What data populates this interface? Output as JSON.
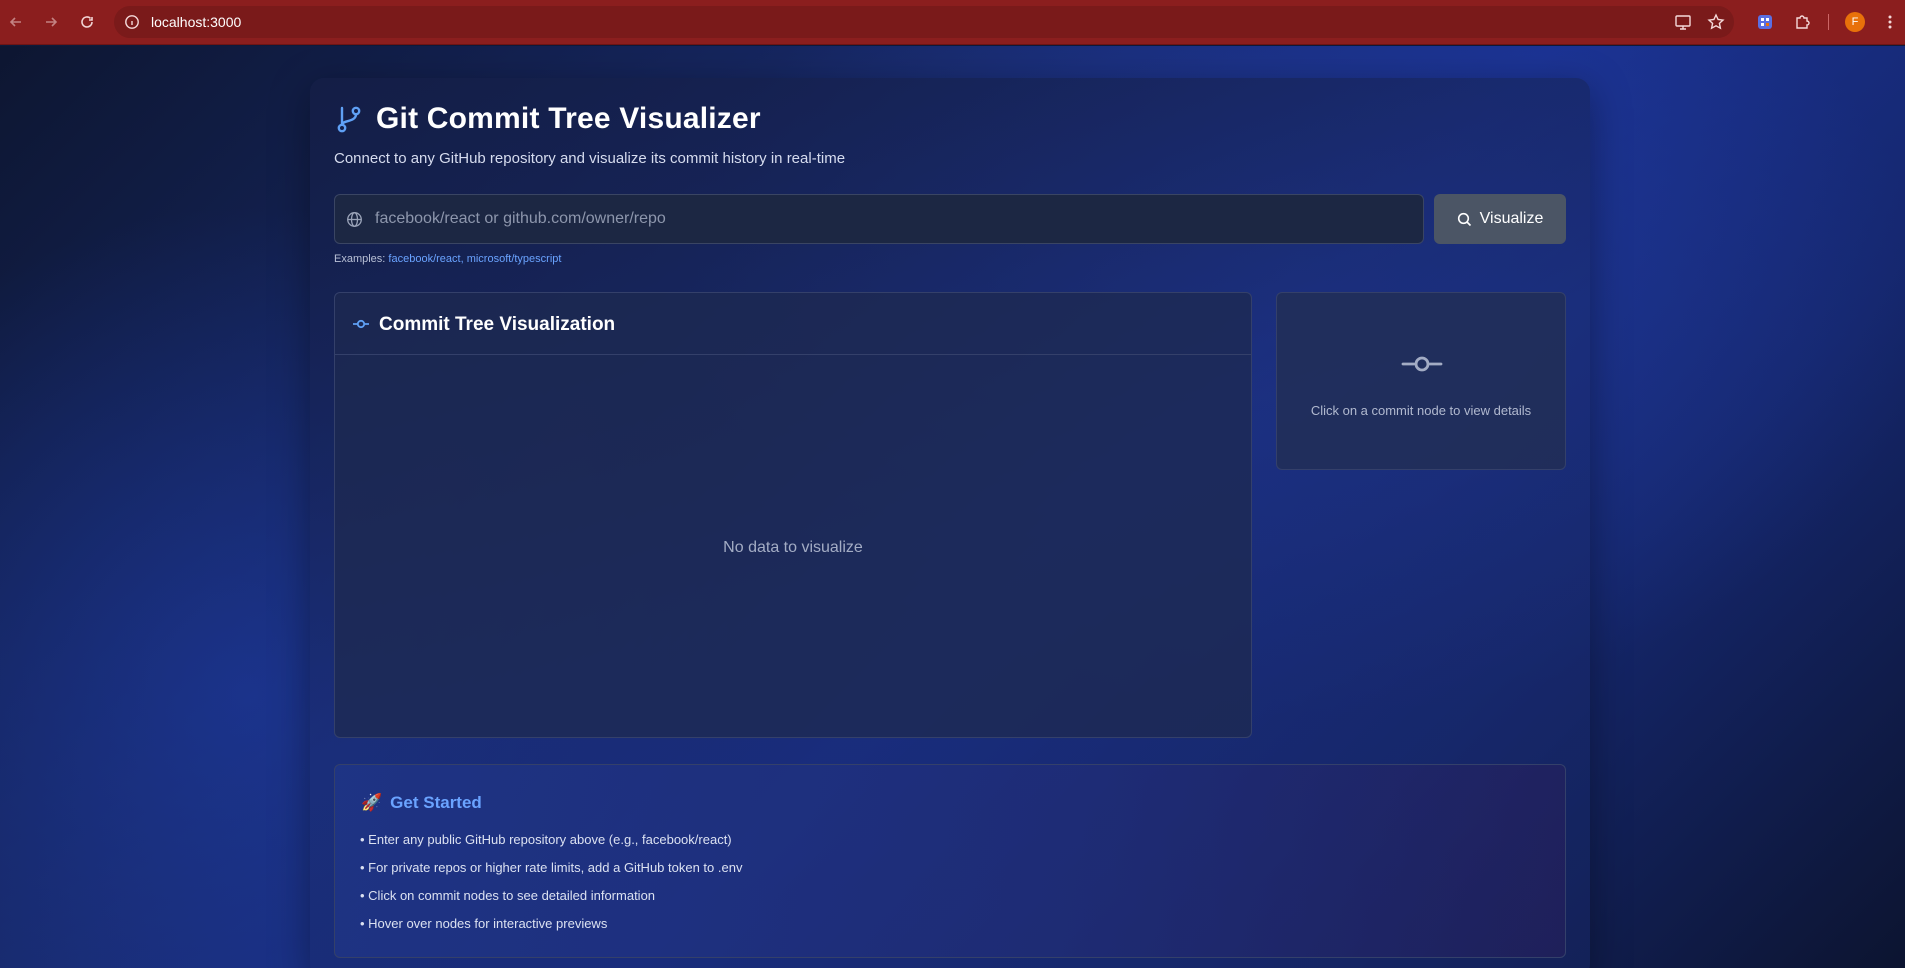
{
  "browser": {
    "url": "localhost:3000",
    "profile_initial": "F"
  },
  "app": {
    "title": "Git Commit Tree Visualizer",
    "subtitle": "Connect to any GitHub repository and visualize its commit history in real-time",
    "accent_color": "#5fa0f5",
    "link_color": "#6aa3ff"
  },
  "search": {
    "placeholder": "facebook/react or github.com/owner/repo",
    "value": "",
    "button_label": "Visualize",
    "examples_label": "Examples:",
    "examples": [
      "facebook/react,",
      "microsoft/typescript"
    ]
  },
  "visualization": {
    "title": "Commit Tree Visualization",
    "empty_message": "No data to visualize"
  },
  "details": {
    "hint": "Click on a commit node to view details"
  },
  "get_started": {
    "icon": "🚀",
    "title": "Get Started",
    "items": [
      "• Enter any public GitHub repository above (e.g., facebook/react)",
      "• For private repos or higher rate limits, add a GitHub token to .env",
      "• Click on commit nodes to see detailed information",
      "• Hover over nodes for interactive previews"
    ]
  },
  "icons": [
    "back-arrow-icon",
    "forward-arrow-icon",
    "reload-icon",
    "site-info-icon",
    "cast-icon",
    "bookmark-star-icon",
    "extension-app-icon",
    "extensions-puzzle-icon",
    "menu-kebab-icon",
    "git-branch-icon",
    "globe-icon",
    "search-icon",
    "git-commit-icon"
  ]
}
